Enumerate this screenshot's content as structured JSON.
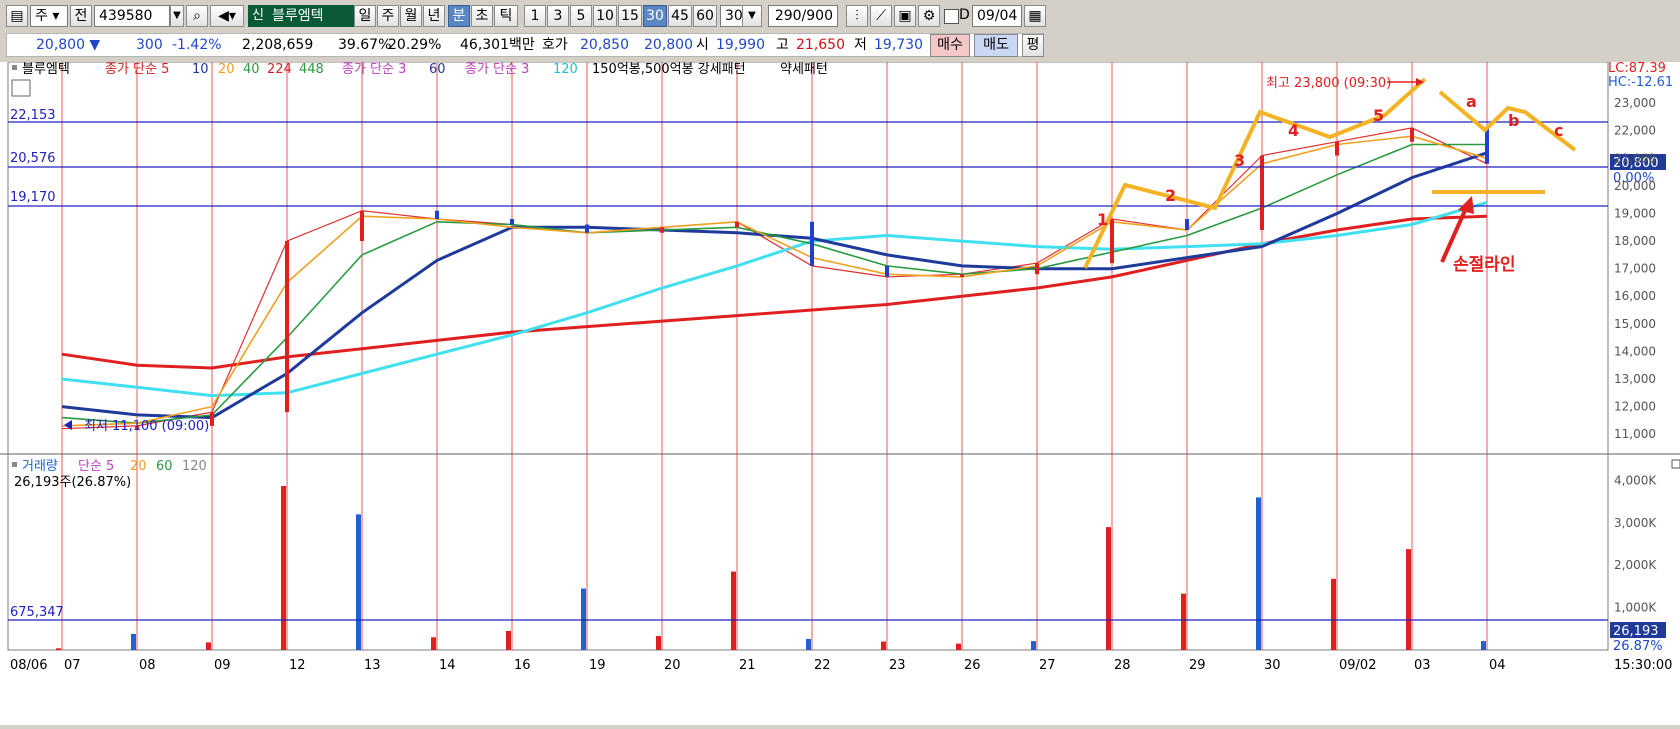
{
  "toolbar": {
    "market": "주",
    "prev": "전",
    "code": "439580",
    "stock_badge": "신",
    "stock_name": "블루엠텍",
    "periods": [
      "일",
      "주",
      "월",
      "년",
      "분",
      "초",
      "틱"
    ],
    "minutes": [
      "1",
      "3",
      "5",
      "10",
      "15",
      "30",
      "45",
      "60"
    ],
    "interval": "30",
    "count": "290/900",
    "date": "09/04",
    "check_label": "D"
  },
  "quote": {
    "price": "20,800 ▼",
    "change": "300",
    "change_pct": "-1.42%",
    "volume": "2,208,659",
    "vol_ratio": "39.67%",
    "turnover_rate": "20.29%",
    "amount": "46,301백만",
    "bid_ask_label": "호가",
    "ask": "20,850",
    "bid": "20,800",
    "open_label": "시",
    "open": "19,990",
    "high_label": "고",
    "high": "21,650",
    "low_label": "저",
    "low": "19,730",
    "buy": "매수",
    "sell": "매도",
    "eval": "평"
  },
  "price_legend": {
    "name": "블루엠텍",
    "ma_label": "종가 단순 5",
    "ma_periods": [
      "10",
      "20",
      "40",
      "224",
      "448"
    ],
    "ma2_label": "종가 단순 3",
    "ma2_period": "60",
    "ma3_label": "종가 단순 3",
    "ma3_period": "120",
    "pattern": "150억봉,500억봉 강세패턴",
    "weak": "약세패턴"
  },
  "hlines": {
    "h1": "22,153",
    "h2": "20,576",
    "h3": "19,170"
  },
  "right_info": {
    "lc": "LC:87.39",
    "hc": "HC:-12.61",
    "price_tag": "20,800",
    "pct_tag": "0.00%"
  },
  "annotations": {
    "high_text": "최고 23,800 (09:30)",
    "low_text": "최저 11,100 (09:00)",
    "waves": [
      "1",
      "2",
      "3",
      "4",
      "5",
      "a",
      "b",
      "c"
    ],
    "stop_line": "손절라인"
  },
  "volume_legend": {
    "name": "거래량",
    "ma_label": "단순 5",
    "ma_periods": [
      "20",
      "60",
      "120"
    ],
    "value": "26,193주(26.87%)",
    "hline": "675,347",
    "tag_value": "26,193",
    "tag_pct": "26.87%"
  },
  "time_axis": {
    "start": "08/06",
    "labels": [
      "07",
      "08",
      "09",
      "12",
      "13",
      "14",
      "16",
      "19",
      "20",
      "21",
      "22",
      "23",
      "26",
      "27",
      "28",
      "29",
      "30",
      "09/02",
      "03",
      "04"
    ],
    "end": "15:30:00"
  },
  "chart_data": {
    "type": "line",
    "ylim": [
      10500,
      24200
    ],
    "price_ticks": [
      "23,000",
      "22,000",
      "21,000",
      "20,000",
      "19,000",
      "18,000",
      "17,000",
      "16,000",
      "15,000",
      "14,000",
      "13,000",
      "12,000",
      "11,000"
    ],
    "volume_ticks": [
      "4,000K",
      "3,000K",
      "2,000K",
      "1,000K"
    ],
    "series": [
      {
        "color": "#e03030",
        "values": [
          11200,
          11300,
          11800,
          18000,
          19100,
          18800,
          18600,
          18300,
          18500,
          18700,
          17100,
          16700,
          16800,
          17200,
          18800,
          18400,
          21100,
          21600,
          22100,
          20800
        ]
      },
      {
        "color": "#e02020",
        "values": [
          13900,
          13500,
          13400,
          13800,
          14100,
          14400,
          14700,
          14900,
          15100,
          15300,
          15500,
          15700,
          16000,
          16300,
          16700,
          17300,
          17900,
          18400,
          18800,
          18900
        ]
      },
      {
        "color": "#40e0f0",
        "values": [
          13000,
          12700,
          12400,
          12500,
          13200,
          13900,
          14600,
          15400,
          16300,
          17100,
          18000,
          18200,
          18000,
          17800,
          17700,
          17800,
          17900,
          18200,
          18600,
          19400
        ]
      },
      {
        "color": "#1f3a9a",
        "values": [
          12000,
          11700,
          11600,
          13200,
          15400,
          17300,
          18500,
          18500,
          18400,
          18300,
          18100,
          17500,
          17100,
          17000,
          17000,
          17400,
          17800,
          19000,
          20300,
          21200
        ]
      },
      {
        "color": "#2a9a40",
        "values": [
          11600,
          11400,
          11700,
          14500,
          17500,
          18700,
          18600,
          18300,
          18400,
          18500,
          17900,
          17100,
          16800,
          17000,
          17600,
          18200,
          19200,
          20400,
          21500,
          21500
        ]
      },
      {
        "color": "#f0a020",
        "values": [
          11300,
          11400,
          12000,
          16500,
          18900,
          18800,
          18500,
          18300,
          18500,
          18700,
          17400,
          16800,
          16700,
          17100,
          18700,
          18400,
          20800,
          21500,
          21800,
          21000
        ]
      }
    ],
    "volume_bars_k": [
      40,
      380,
      180,
      3870,
      3200,
      300,
      450,
      1450,
      330,
      1850,
      260,
      200,
      150,
      210,
      2900,
      1330,
      3600,
      1680,
      2380,
      210
    ]
  }
}
